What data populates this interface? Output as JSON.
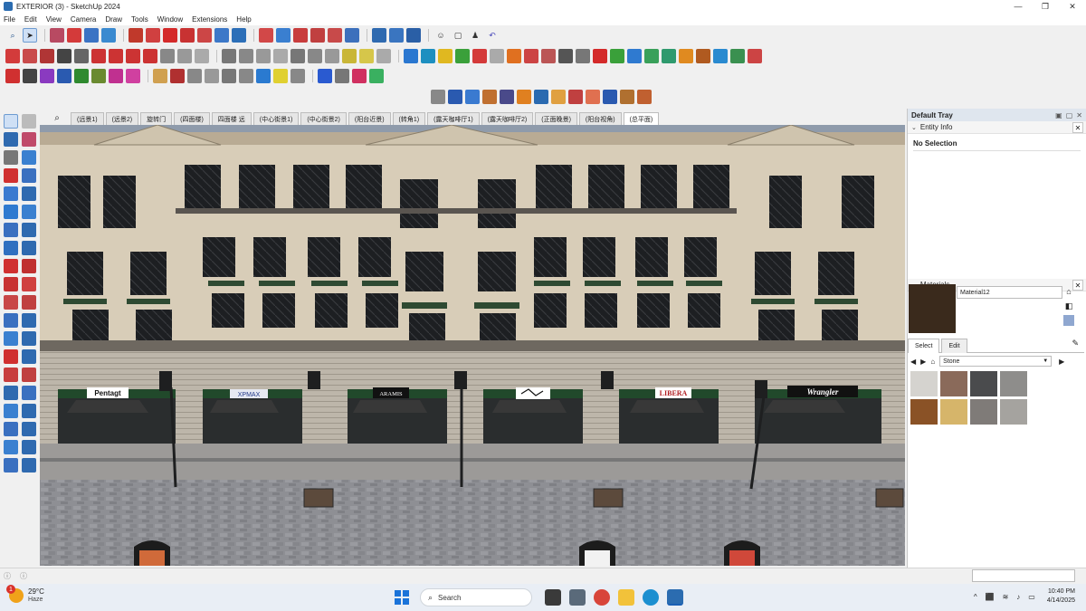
{
  "window": {
    "title": "EXTERIOR  (3) - SketchUp 2024",
    "controls": [
      "—",
      "❐",
      "✕"
    ]
  },
  "menu": {
    "items": [
      "File",
      "Edit",
      "View",
      "Camera",
      "Draw",
      "Tools",
      "Window",
      "Extensions",
      "Help"
    ]
  },
  "scene_tabs": [
    "(远景1)",
    "(远景2)",
    "旋转门",
    "(四面楼)",
    "四面楼 远",
    "(中心街景1)",
    "(中心街景2)",
    "(阳台近景)",
    "(转角1)",
    "(露天咖啡厅1)",
    "(露天咖啡厅2)",
    "(正面晚景)",
    "(阳台视角)",
    "(总平面)"
  ],
  "tray": {
    "title": "Default Tray",
    "entity_info": {
      "title": "Entity Info",
      "selection": "No Selection"
    },
    "materials": {
      "title": "Materials",
      "material_name": "Material12",
      "tab_select": "Select",
      "tab_edit": "Edit",
      "collection": "Stone",
      "swatch_colors": [
        "#d5d3cf",
        "#8a6a5a",
        "#4a4b4d",
        "#8e8d8b",
        "#8a5226",
        "#d6b56a",
        "#7f7b78",
        "#a5a39f"
      ]
    }
  },
  "storefront_signs": [
    "Pentagt",
    "XPMAX",
    "ARAMIS",
    "",
    "LIBERA",
    "Wrangler"
  ],
  "taskbar": {
    "temperature": "29°C",
    "condition": "Haze",
    "weather_badge": "1",
    "search_placeholder": "Search",
    "time": "10:40 PM",
    "date": "4/14/2025"
  }
}
